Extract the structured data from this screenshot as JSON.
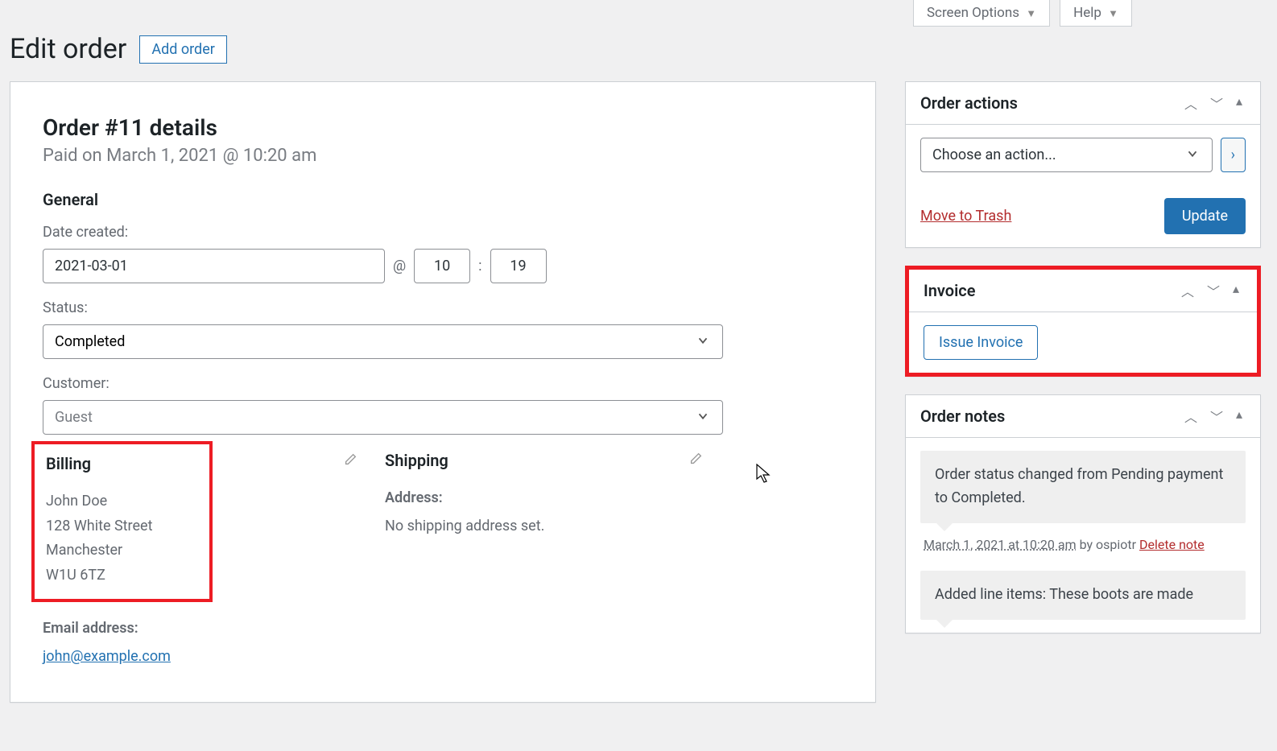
{
  "topBar": {
    "screenOptions": "Screen Options",
    "help": "Help"
  },
  "page": {
    "title": "Edit order",
    "addOrder": "Add order"
  },
  "order": {
    "heading": "Order #11 details",
    "subtitle": "Paid on March 1, 2021 @ 10:20 am",
    "general": {
      "title": "General",
      "dateLabel": "Date created:",
      "date": "2021-03-01",
      "hour": "10",
      "minute": "19",
      "statusLabel": "Status:",
      "status": "Completed",
      "customerLabel": "Customer:",
      "customer": "Guest"
    },
    "billing": {
      "title": "Billing",
      "name": "John Doe",
      "street": "128 White Street",
      "city": "Manchester",
      "postcode": "W1U 6TZ",
      "emailLabel": "Email address:",
      "email": "john@example.com"
    },
    "shipping": {
      "title": "Shipping",
      "addressLabel": "Address:",
      "addressValue": "No shipping address set."
    }
  },
  "sidebar": {
    "actions": {
      "title": "Order actions",
      "choose": "Choose an action...",
      "trash": "Move to Trash",
      "update": "Update"
    },
    "invoice": {
      "title": "Invoice",
      "issue": "Issue Invoice"
    },
    "notes": {
      "title": "Order notes",
      "items": [
        {
          "text": "Order status changed from Pending payment to Completed.",
          "date": "March 1, 2021 at 10:20 am",
          "by": " by ospiotr ",
          "delete": "Delete note"
        },
        {
          "text": "Added line items: These boots are made"
        }
      ]
    }
  }
}
